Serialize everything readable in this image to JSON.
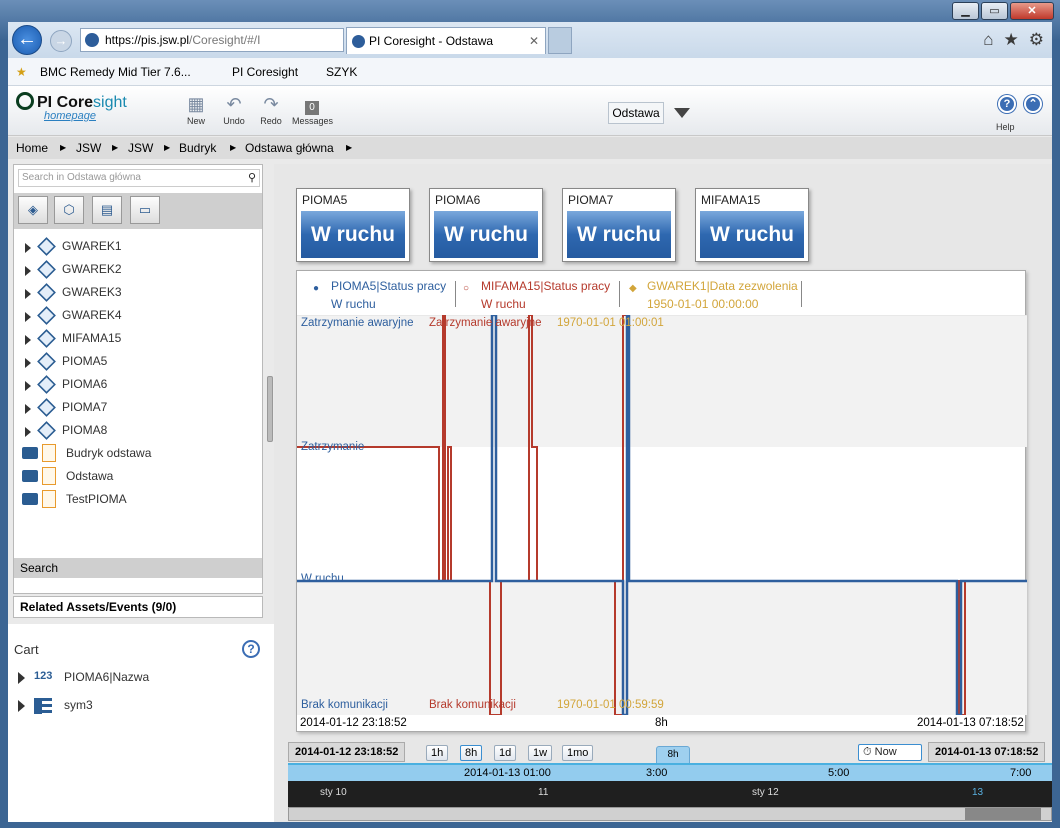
{
  "browser": {
    "url_host": "https://pis.jsw.pl",
    "url_rest": "/Coresight/#/I",
    "tab_title": "PI Coresight - Odstawa",
    "favorites": [
      "BMC Remedy Mid Tier 7.6...",
      "PI Coresight",
      "SZYK"
    ]
  },
  "header": {
    "logo": "PI Core",
    "logo_suffix": "sight",
    "home_link": "homepage",
    "tools": [
      {
        "label": "New",
        "icon": "new-icon"
      },
      {
        "label": "Undo",
        "icon": "undo-icon"
      },
      {
        "label": "Redo",
        "icon": "redo-icon"
      },
      {
        "label": "Messages",
        "icon": "messages-icon",
        "badge": "0"
      }
    ],
    "display_selector": "Odstawa",
    "help_label": "Help"
  },
  "breadcrumbs": [
    "Home",
    "JSW",
    "JSW",
    "Budryk",
    "Odstawa główna"
  ],
  "left_panel": {
    "search_placeholder": "Search in Odstawa główna",
    "assets": [
      "GWAREK1",
      "GWAREK2",
      "GWAREK3",
      "GWAREK4",
      "MIFAMA15",
      "PIOMA5",
      "PIOMA6",
      "PIOMA7",
      "PIOMA8"
    ],
    "displays": [
      "Budryk odstawa",
      "Odstawa",
      "TestPIOMA"
    ],
    "search_bar": "Search",
    "related": "Related Assets/Events (9/0)"
  },
  "cart": {
    "title": "Cart",
    "items": [
      {
        "icon": "123",
        "label": "PIOMA6|Nazwa"
      },
      {
        "icon": "grid",
        "label": "sym3"
      }
    ]
  },
  "symbols": [
    {
      "name": "PIOMA5",
      "value": "W ruchu"
    },
    {
      "name": "PIOMA6",
      "value": "W ruchu"
    },
    {
      "name": "PIOMA7",
      "value": "W ruchu"
    },
    {
      "name": "MIFAMA15",
      "value": "W ruchu"
    }
  ],
  "trend": {
    "legend": [
      {
        "name": "PIOMA5|Status pracy",
        "value": "W ruchu",
        "color": "#2e5f9e"
      },
      {
        "name": "MIFAMA15|Status pracy",
        "value": "W ruchu",
        "color": "#b53a2c"
      },
      {
        "name": "GWAREK1|Data zezwolenia",
        "value": "1950-01-01 00:00:00",
        "color": "#d2a53a"
      }
    ],
    "y_labels_blue": [
      "Zatrzymanie awaryjne",
      "Zatrzymanie",
      "W ruchu",
      "Brak komunikacji"
    ],
    "y_labels_red": [
      "Zatrzymanie awaryjne",
      "Brak komunikacji"
    ],
    "y_labels_gold": [
      "1970-01-01 01:00:01",
      "1970-01-01 00:59:59"
    ],
    "start": "2014-01-12 23:18:52",
    "duration": "8h",
    "end": "2014-01-13 07:18:52"
  },
  "timebar": {
    "start": "2014-01-12 23:18:52",
    "buttons": [
      "1h",
      "8h",
      "1d",
      "1w",
      "1mo"
    ],
    "selected": "8h",
    "now": "Now",
    "end": "2014-01-13 07:18:52",
    "tab": "8h",
    "cyan_ticks": [
      "2014-01-13 01:00",
      "3:00",
      "5:00",
      "7:00"
    ],
    "dark_ticks": [
      "sty 10",
      "11",
      "sty 12",
      "13"
    ]
  }
}
